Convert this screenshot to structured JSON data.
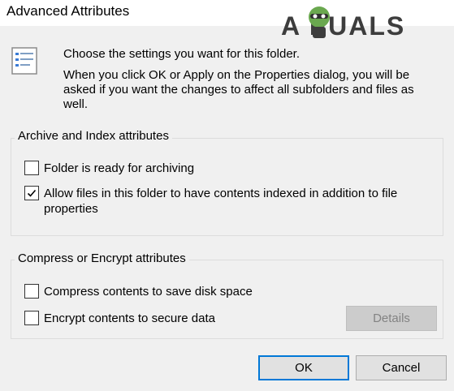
{
  "window": {
    "title": "Advanced Attributes"
  },
  "watermark": {
    "text": "A  PUALS"
  },
  "intro": {
    "line1": "Choose the settings you want for this folder.",
    "line2": "When you click OK or Apply on the Properties dialog, you will be asked if you want the changes to affect all subfolders and files as well."
  },
  "archive_group": {
    "label": "Archive and Index attributes",
    "items": [
      {
        "label": "Folder is ready for archiving",
        "checked": false
      },
      {
        "label": "Allow files in this folder to have contents indexed in addition to file properties",
        "checked": true
      }
    ]
  },
  "compress_group": {
    "label": "Compress or Encrypt attributes",
    "items": [
      {
        "label": "Compress contents to save disk space",
        "checked": false
      },
      {
        "label": "Encrypt contents to secure data",
        "checked": false
      }
    ],
    "details_button": "Details"
  },
  "buttons": {
    "ok": "OK",
    "cancel": "Cancel"
  },
  "icons": {
    "folder_settings": "folder-settings-icon",
    "close": "close-icon",
    "check": "checkmark-icon"
  },
  "colors": {
    "accent": "#0078d7",
    "background": "#f0f0f0"
  }
}
